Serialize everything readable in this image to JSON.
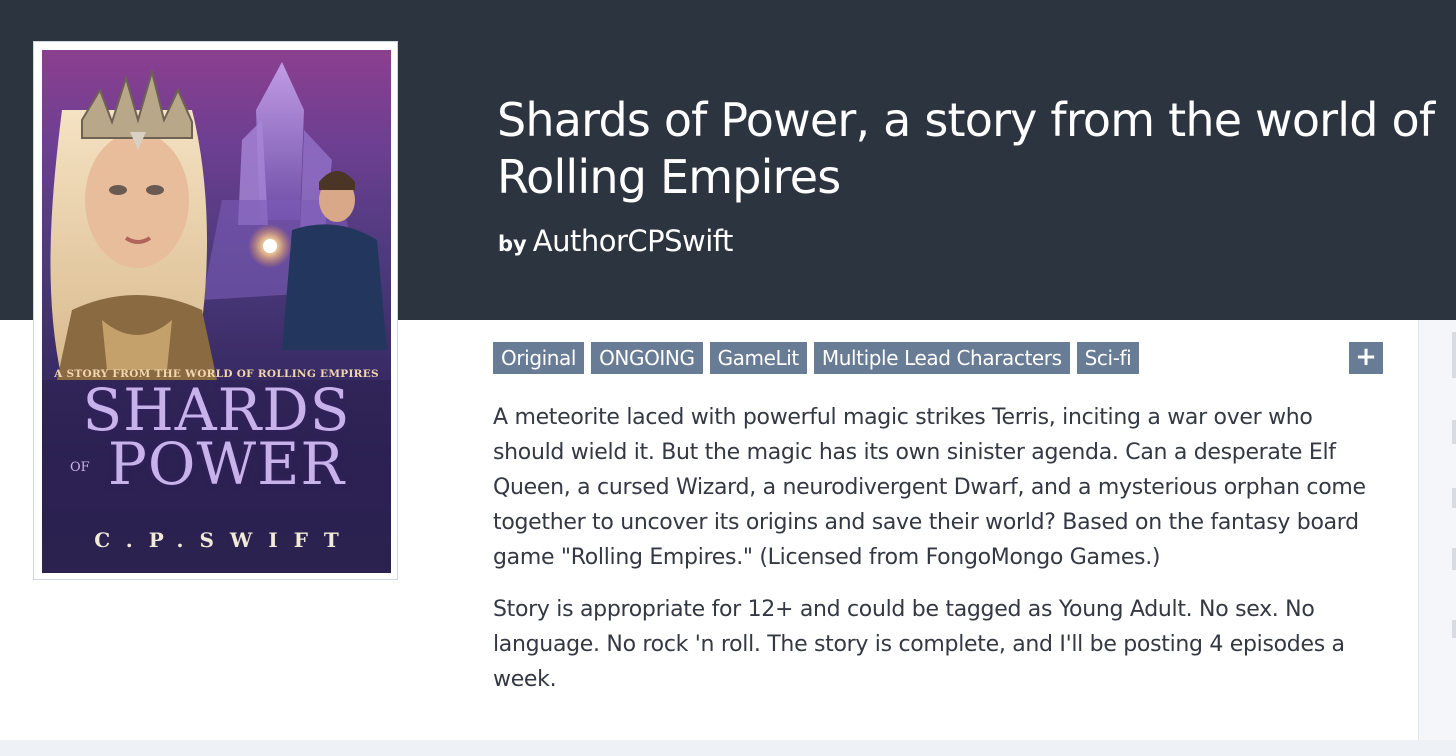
{
  "fiction": {
    "title": "Shards of Power, a story from the world of Rolling Empires",
    "byline_prefix": "by",
    "author": "AuthorCPSwift",
    "tags": [
      "Original",
      "ONGOING",
      "GameLit",
      "Multiple Lead Characters",
      "Sci-fi"
    ],
    "add_tag_label": "+",
    "description": [
      "A meteorite laced with powerful magic strikes Terris, inciting a war over who should wield it. But the magic has its own sinister agenda. Can a desperate Elf Queen, a cursed Wizard, a neurodivergent Dwarf, and a mysterious orphan come together to uncover its origins and save their world? Based on the fantasy board game \"Rolling Empires.\" (Licensed from FongoMongo Games.)",
      "Story is appropriate for 12+ and could be tagged as Young Adult. No sex. No language. No rock 'n roll. The story is complete, and I'll be posting 4 episodes a week."
    ]
  },
  "cover": {
    "tagline": "A STORY FROM THE WORLD OF ROLLING EMPIRES",
    "title_line1": "SHARDS",
    "title_of": "OF",
    "title_line2": "POWER",
    "author": "C.P.SWIFT"
  },
  "colors": {
    "header_bg": "#2c3440",
    "tag_bg": "#687c96",
    "body_text": "#333842",
    "page_bg": "#eef1f5"
  }
}
